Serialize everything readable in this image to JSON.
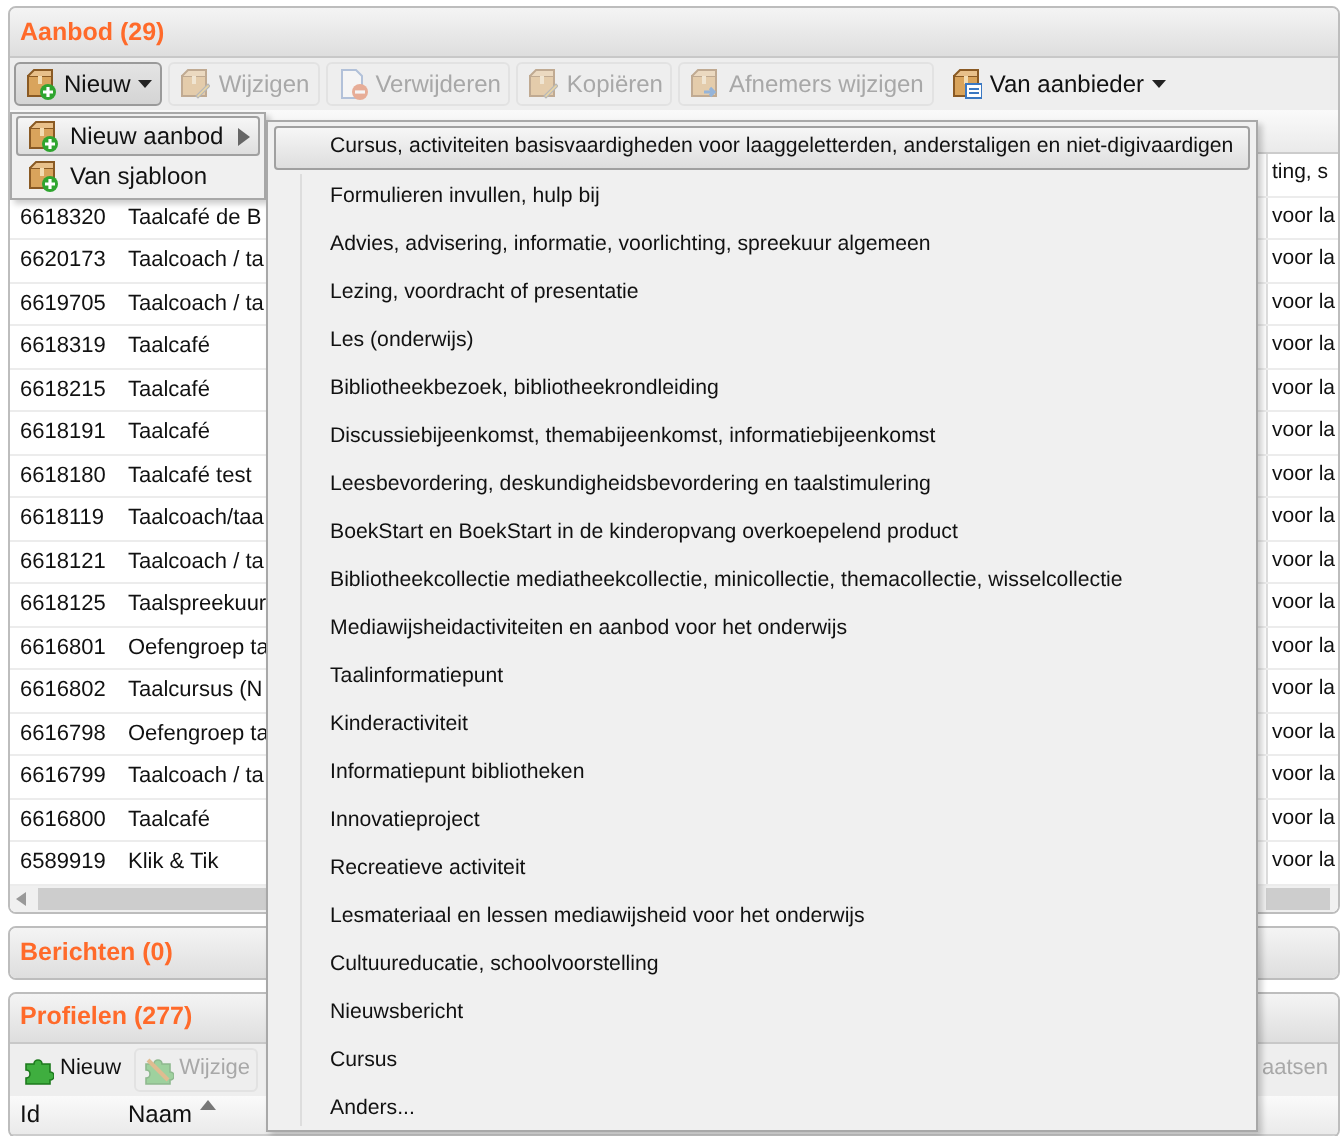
{
  "aanbod": {
    "title": "Aanbod (29)",
    "toolbar": [
      {
        "label": "Nieuw",
        "disabled": false,
        "pressed": true,
        "dropdown": true
      },
      {
        "label": "Wijzigen",
        "disabled": true,
        "pressed": false,
        "dropdown": false
      },
      {
        "label": "Verwijderen",
        "disabled": true,
        "pressed": false,
        "dropdown": false
      },
      {
        "label": "Kopiëren",
        "disabled": true,
        "pressed": false,
        "dropdown": false
      },
      {
        "label": "Afnemers wijzigen",
        "disabled": true,
        "pressed": false,
        "dropdown": false
      },
      {
        "label": "Van aanbieder",
        "disabled": false,
        "pressed": false,
        "dropdown": true
      }
    ],
    "rows": [
      {
        "column_3": "ting, s"
      },
      {
        "id": "6618320",
        "naam": "Taalcafé de B",
        "column_3": "voor la"
      },
      {
        "id": "6620173",
        "naam": "Taalcoach / ta",
        "column_3": "voor la"
      },
      {
        "id": "6619705",
        "naam": "Taalcoach / ta",
        "column_3": "voor la"
      },
      {
        "id": "6618319",
        "naam": "Taalcafé",
        "column_3": "voor la"
      },
      {
        "id": "6618215",
        "naam": "Taalcafé",
        "column_3": "voor la"
      },
      {
        "id": "6618191",
        "naam": "Taalcafé",
        "column_3": "voor la"
      },
      {
        "id": "6618180",
        "naam": "Taalcafé test",
        "column_3": "voor la"
      },
      {
        "id": "6618119",
        "naam": "Taalcoach/taa",
        "column_3": "voor la"
      },
      {
        "id": "6618121",
        "naam": "Taalcoach / ta",
        "column_3": "voor la"
      },
      {
        "id": "6618125",
        "naam": "Taalspreekuur",
        "column_3": "voor la"
      },
      {
        "id": "6616801",
        "naam": "Oefengroep ta",
        "column_3": "voor la"
      },
      {
        "id": "6616802",
        "naam": "Taalcursus (N",
        "column_3": "voor la"
      },
      {
        "id": "6616798",
        "naam": "Oefengroep ta",
        "column_3": "voor la"
      },
      {
        "id": "6616799",
        "naam": "Taalcoach / ta",
        "column_3": "voor la"
      },
      {
        "id": "6616800",
        "naam": "Taalcafé",
        "column_3": "voor la"
      },
      {
        "id": "6589919",
        "naam": "Klik & Tik",
        "column_3": "voor la"
      }
    ]
  },
  "menu": {
    "items": [
      {
        "label": "Nieuw aanbod",
        "selected": true,
        "submenu": true
      },
      {
        "label": "Van sjabloon",
        "selected": false,
        "submenu": false
      }
    ]
  },
  "submenu": {
    "items": [
      {
        "label": "Cursus, activiteiten basisvaardigheden voor laaggeletterden, anderstaligen en niet-digivaardigen",
        "selected": true
      },
      {
        "label": "Formulieren invullen, hulp bij",
        "selected": false
      },
      {
        "label": "Advies, advisering, informatie, voorlichting, spreekuur algemeen",
        "selected": false
      },
      {
        "label": "Lezing, voordracht of presentatie",
        "selected": false
      },
      {
        "label": "Les (onderwijs)",
        "selected": false
      },
      {
        "label": "Bibliotheekbezoek, bibliotheekrondleiding",
        "selected": false
      },
      {
        "label": "Discussiebijeenkomst, themabijeenkomst, informatiebijeenkomst",
        "selected": false
      },
      {
        "label": "Leesbevordering, deskundigheidsbevordering en taalstimulering",
        "selected": false
      },
      {
        "label": "BoekStart en BoekStart in de kinderopvang overkoepelend product",
        "selected": false
      },
      {
        "label": "Bibliotheekcollectie mediatheekcollectie, minicollectie, themacollectie, wisselcollectie",
        "selected": false
      },
      {
        "label": "Mediawijsheidactiviteiten en aanbod voor het onderwijs",
        "selected": false
      },
      {
        "label": "Taalinformatiepunt",
        "selected": false
      },
      {
        "label": "Kinderactiviteit",
        "selected": false
      },
      {
        "label": "Informatiepunt bibliotheken",
        "selected": false
      },
      {
        "label": "Innovatieproject",
        "selected": false
      },
      {
        "label": "Recreatieve activiteit",
        "selected": false
      },
      {
        "label": "Lesmateriaal en lessen mediawijsheid voor het onderwijs",
        "selected": false
      },
      {
        "label": "Cultuureducatie, schoolvoorstelling",
        "selected": false
      },
      {
        "label": "Nieuwsbericht",
        "selected": false
      },
      {
        "label": "Cursus",
        "selected": false
      },
      {
        "label": "Anders...",
        "selected": false
      }
    ]
  },
  "berichten": {
    "title": "Berichten (0)"
  },
  "profielen": {
    "title": "Profielen (277)",
    "toolbar": [
      {
        "label": "Nieuw",
        "disabled": false
      },
      {
        "label": "Wijzige",
        "disabled": true
      },
      {
        "label": "aatsen",
        "disabled": true
      }
    ],
    "columns": [
      {
        "label": "Id",
        "sorted": false
      },
      {
        "label": "Naam",
        "sorted": true
      }
    ]
  }
}
